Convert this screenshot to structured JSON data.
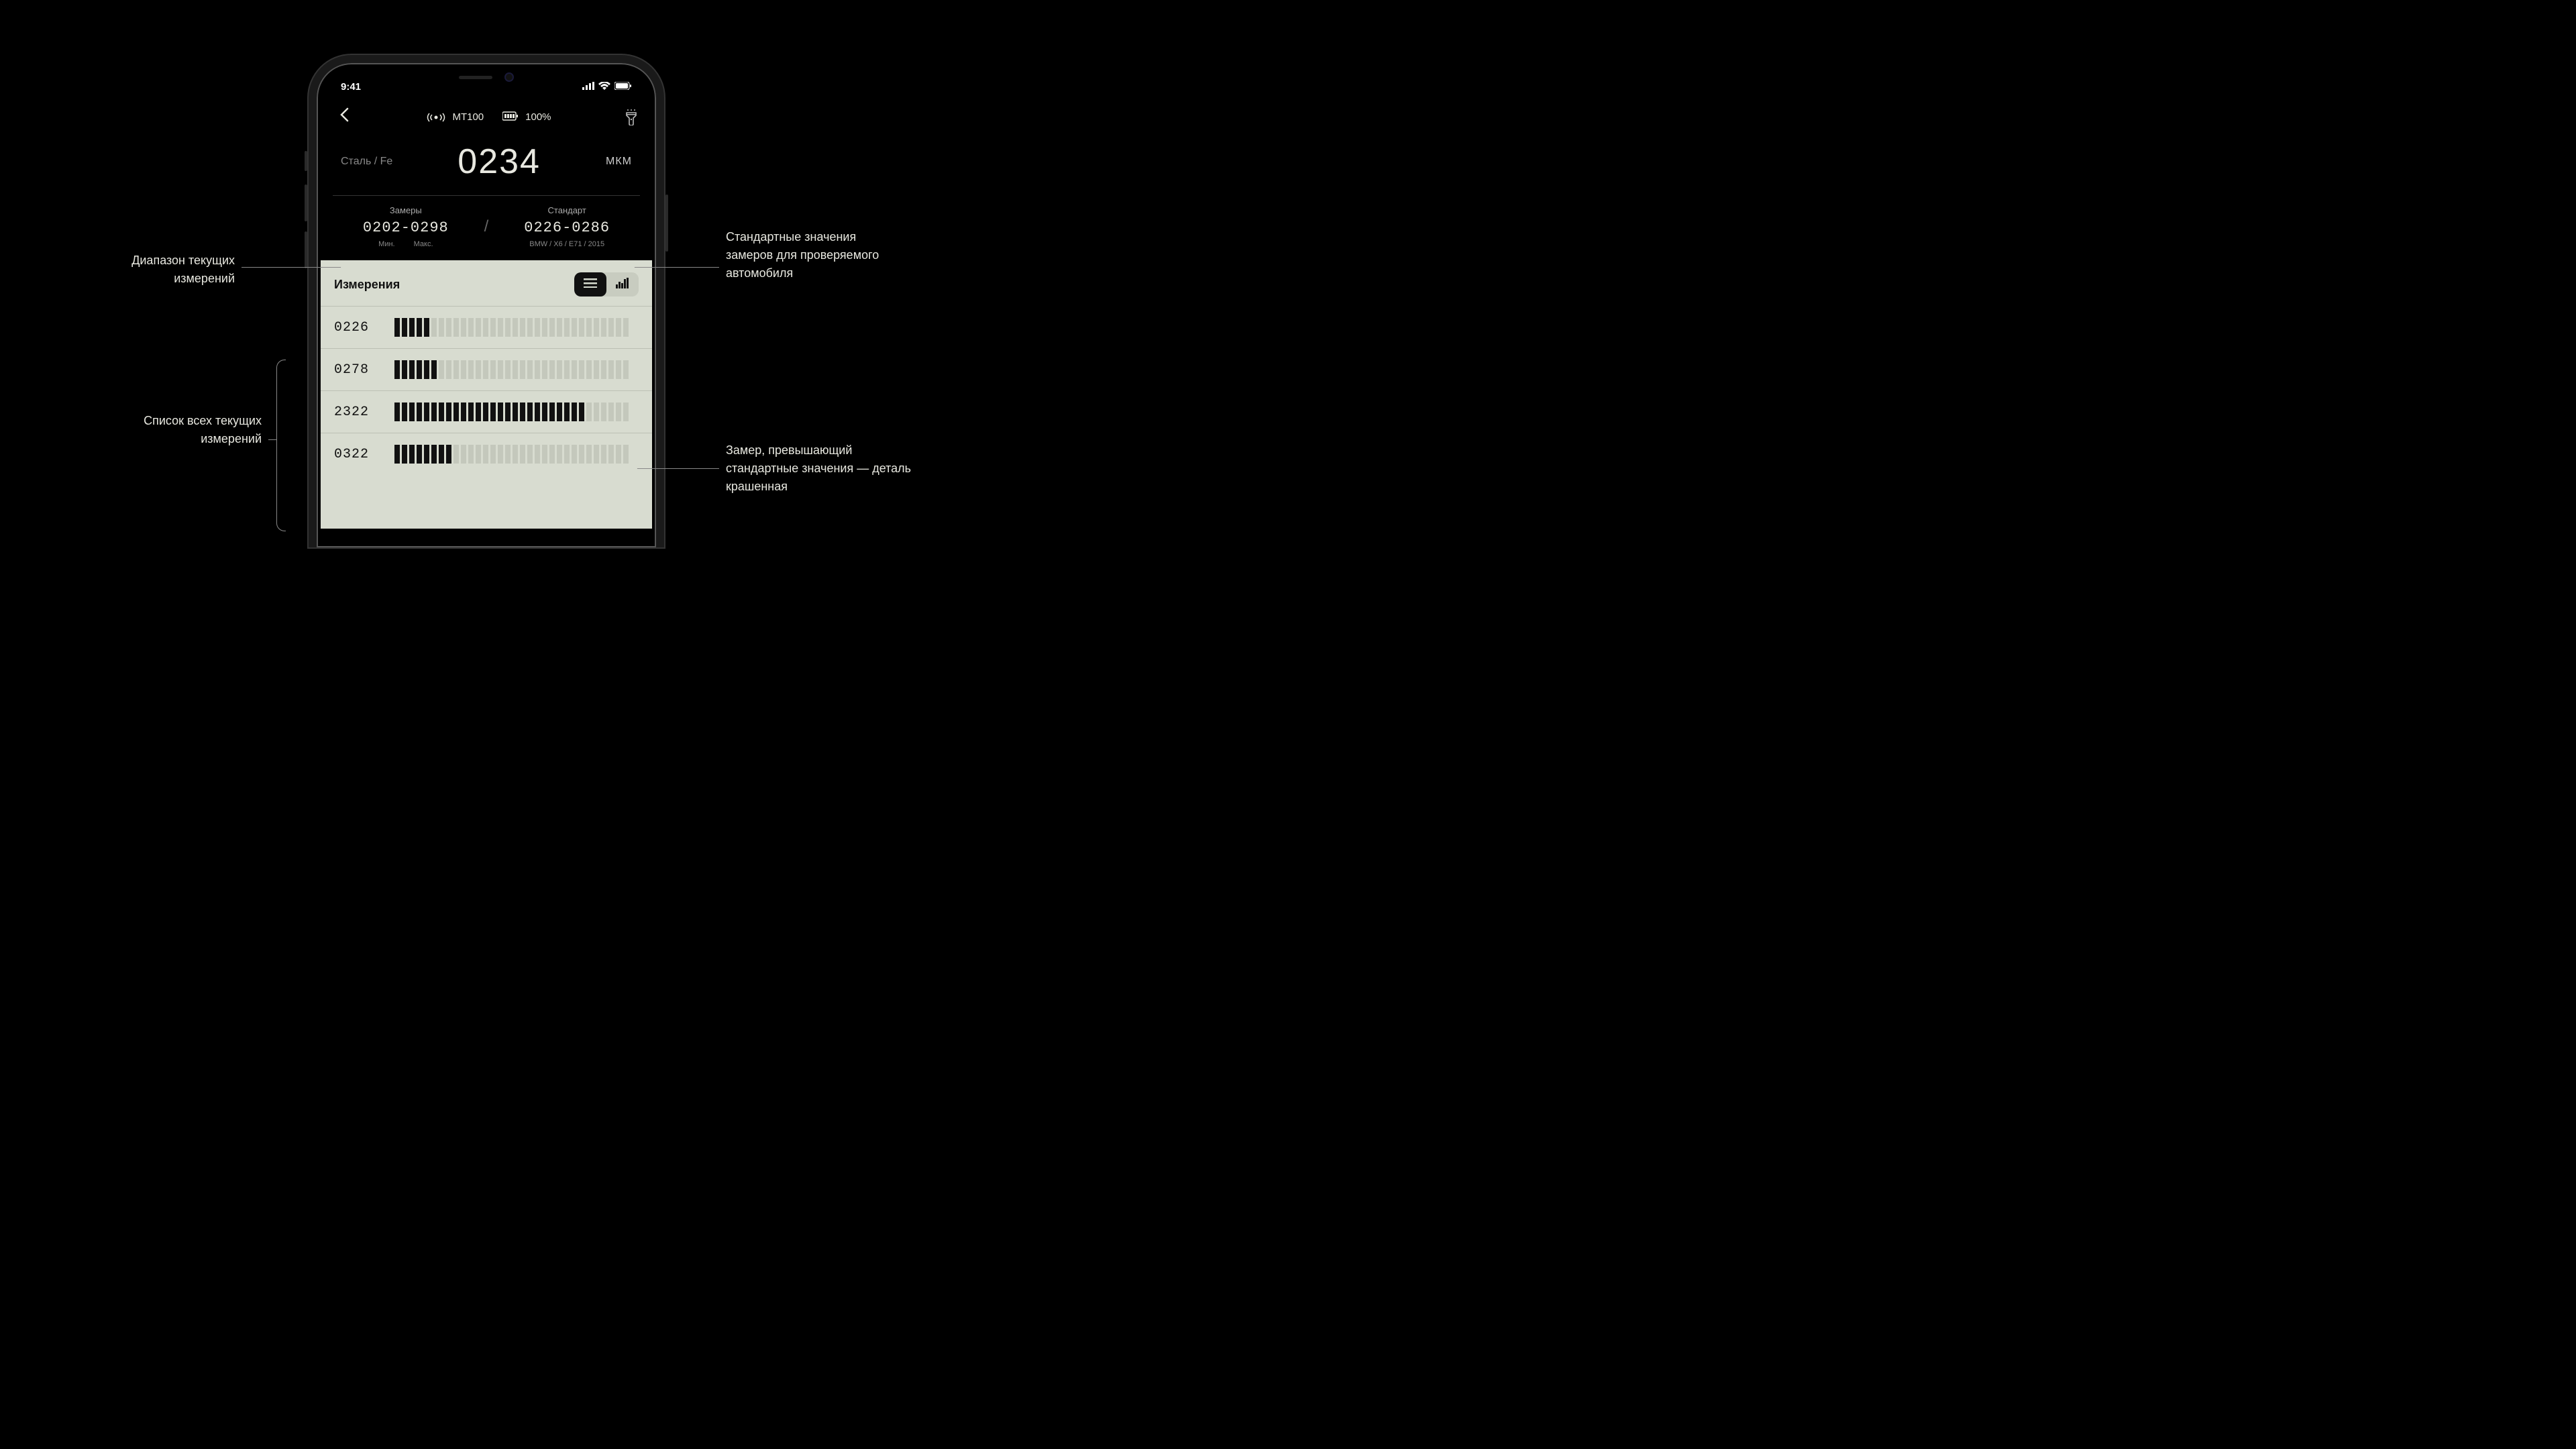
{
  "status": {
    "time": "9:41"
  },
  "header": {
    "device": "MT100",
    "battery": "100%"
  },
  "reading": {
    "material": "Сталь / Fe",
    "value": "0234",
    "unit": "МКМ"
  },
  "ranges": {
    "measured": {
      "label": "Замеры",
      "value": "0202-0298",
      "min_label": "Мин.",
      "max_label": "Макс."
    },
    "standard": {
      "label": "Стандарт",
      "value": "0226-0286",
      "vehicle": "BMW / X6 / E71 / 2015"
    }
  },
  "panel": {
    "title": "Измерения"
  },
  "measurements": [
    {
      "value": "0226",
      "fill": 5
    },
    {
      "value": "0278",
      "fill": 6
    },
    {
      "value": "2322",
      "fill": 26
    },
    {
      "value": "0322",
      "fill": 8
    }
  ],
  "annotations": {
    "range_left": "Диапазон текущих измерений",
    "range_right": "Стандартные значения замеров для проверяемого автомобиля",
    "list_left": "Список всех текущих измерений",
    "exceed_right": "Замер, превышающий стандартные значения — деталь крашенная"
  }
}
